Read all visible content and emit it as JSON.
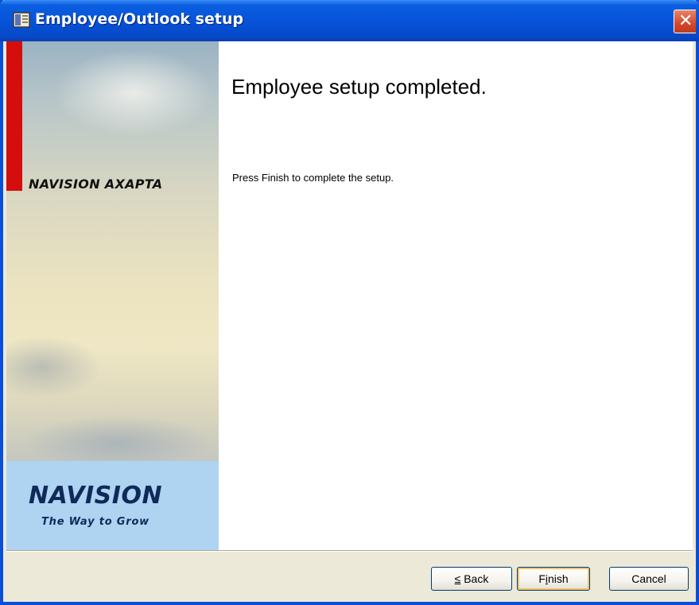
{
  "window": {
    "title": "Employee/Outlook setup"
  },
  "branding": {
    "product_logo": "NAVISION AXAPTA",
    "company_logo": "NAVISION",
    "tagline": "The Way to Grow",
    "accent_red": "#d40d0d",
    "logo_blue": "#0f2a59"
  },
  "content": {
    "heading": "Employee setup completed.",
    "instruction": "Press Finish to complete the setup."
  },
  "buttons": {
    "back_mnemonic": "≤",
    "back_rest": " Back",
    "finish_first": "F",
    "finish_mnemonic": "i",
    "finish_rest": "nish",
    "cancel": "Cancel"
  },
  "icons": {
    "title": "app-window-icon",
    "close": "close-icon"
  }
}
